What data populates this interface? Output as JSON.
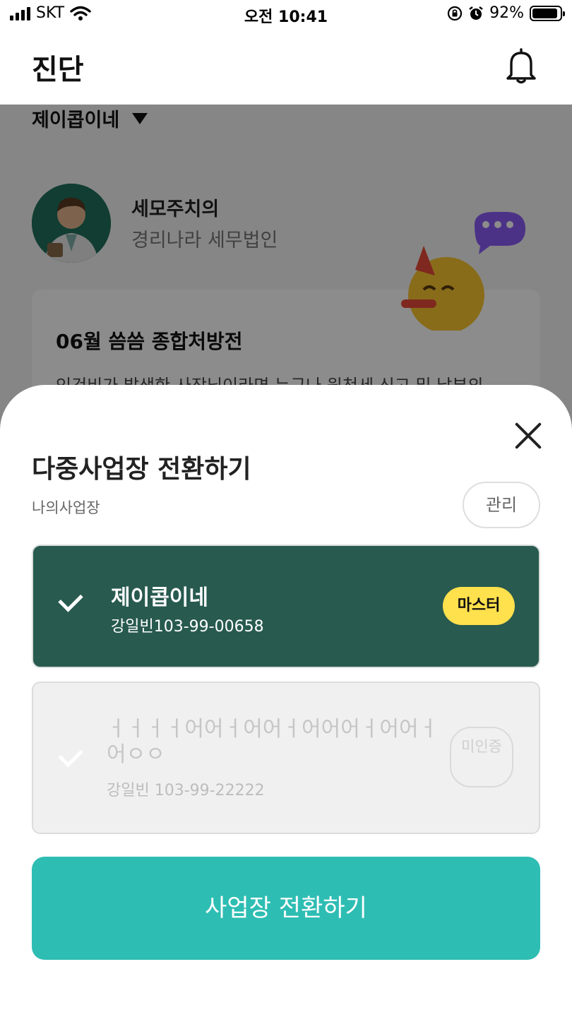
{
  "status_bar": {
    "carrier": "SKT",
    "time": "오전 10:41",
    "battery": "92%",
    "battery_level": 0.92
  },
  "header": {
    "title": "진단",
    "icon": "bell-icon"
  },
  "background": {
    "business_selector": "제이콥이네",
    "advisor_name": "세모주치의",
    "advisor_firm": "경리나라 세무법인",
    "card_title": "06월 씀씀 종합처방전",
    "card_desc": "인건비가 발생한 사장님이라면 누구나 원천세 신고 및 납부의"
  },
  "sheet": {
    "title": "다중사업장 전환하기",
    "subtitle": "나의사업장",
    "manage_label": "관리",
    "businesses": [
      {
        "name": "제이콥이네",
        "reg": "강일빈103-99-00658",
        "badge": "마스터",
        "selected": true
      },
      {
        "name": "ㅓㅓㅓㅓ어어ㅓ어어ㅓ어어어ㅓ어어ㅓ어ㅇㅇ",
        "reg": "강일빈 103-99-22222",
        "badge": "미인증",
        "selected": false
      }
    ],
    "switch_label": "사업장 전환하기"
  },
  "colors": {
    "primary_teal": "#2ebdb3",
    "selected_card": "#285a4f",
    "master_badge": "#ffe04d"
  }
}
